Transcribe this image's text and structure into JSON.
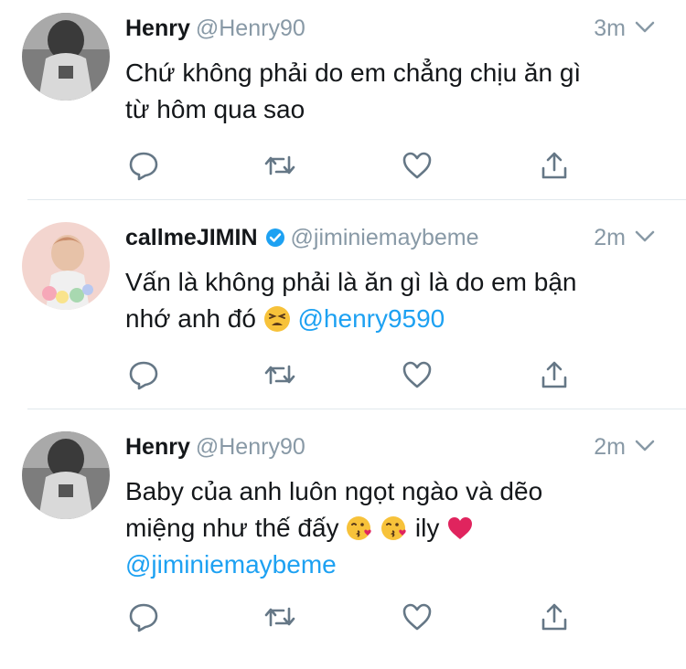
{
  "tweets": [
    {
      "name": "Henry",
      "handle": "@Henry90",
      "time": "3m",
      "text_line1": "Chứ không phải do em chẳng chịu ăn gì",
      "text_line2": "từ hôm qua sao",
      "avatar_icon": "avatar-photo-grayscale"
    },
    {
      "name": "callmeJIMIN",
      "handle": "@jiminiemaybeme",
      "time": "2m",
      "verified": true,
      "text_line1": "Vấn là không phải là ăn gì là do em bận",
      "text_line2_pre": "nhớ anh đó",
      "text_line2_emoji": "tired-face-emoji",
      "text_line2_mention": "@henry9590",
      "avatar_icon": "avatar-photo-pastel"
    },
    {
      "name": "Henry",
      "handle": "@Henry90",
      "time": "2m",
      "text_line1": "Baby của anh luôn ngọt ngào và dẽo",
      "text_line2_pre": "miệng như thế đấy",
      "text_line2_emojis": [
        "kiss-face-emoji",
        "kiss-face-emoji"
      ],
      "text_line2_post": "ily",
      "text_line2_heart": "red-heart-emoji",
      "text_line3_mention": "@jiminiemaybeme",
      "avatar_icon": "avatar-photo-grayscale"
    }
  ],
  "actions": [
    "reply-icon",
    "retweet-icon",
    "like-icon",
    "share-icon"
  ],
  "colors": {
    "accent": "#1da1f2",
    "muted": "#8899a6",
    "divider": "#e1e8ed",
    "text": "#14171a"
  }
}
